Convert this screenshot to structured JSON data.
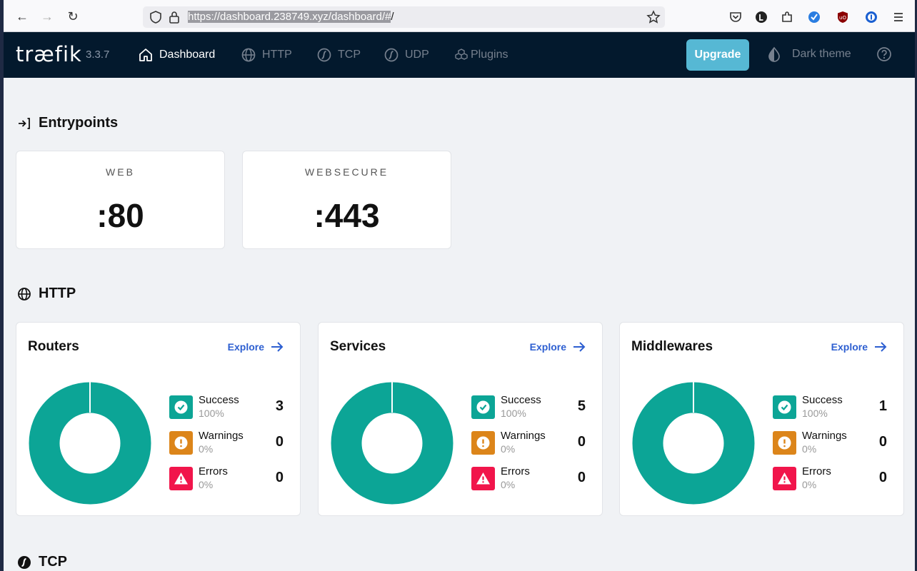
{
  "browser": {
    "url_selected": "https://dashboard.238749.xyz/dashboard/#",
    "url_rest": "/"
  },
  "header": {
    "logo": "træfik",
    "version": "3.3.7",
    "nav": [
      {
        "label": "Dashboard",
        "icon": "home-icon",
        "active": true
      },
      {
        "label": "HTTP",
        "icon": "globe-icon",
        "active": false
      },
      {
        "label": "TCP",
        "icon": "tcp-icon",
        "active": false
      },
      {
        "label": "UDP",
        "icon": "udp-icon",
        "active": false
      },
      {
        "label": "Plugins",
        "icon": "plugins-icon",
        "active": false
      }
    ],
    "upgrade_label": "Upgrade",
    "dark_theme_label": "Dark theme"
  },
  "entrypoints": {
    "title": "Entrypoints",
    "items": [
      {
        "name": "WEB",
        "port": ":80"
      },
      {
        "name": "WEBSECURE",
        "port": ":443"
      }
    ]
  },
  "http": {
    "title": "HTTP",
    "cards": [
      {
        "title": "Routers",
        "explore": "Explore",
        "success": {
          "label": "Success",
          "pct": "100%",
          "count": "3"
        },
        "warnings": {
          "label": "Warnings",
          "pct": "0%",
          "count": "0"
        },
        "errors": {
          "label": "Errors",
          "pct": "0%",
          "count": "0"
        }
      },
      {
        "title": "Services",
        "explore": "Explore",
        "success": {
          "label": "Success",
          "pct": "100%",
          "count": "5"
        },
        "warnings": {
          "label": "Warnings",
          "pct": "0%",
          "count": "0"
        },
        "errors": {
          "label": "Errors",
          "pct": "0%",
          "count": "0"
        }
      },
      {
        "title": "Middlewares",
        "explore": "Explore",
        "success": {
          "label": "Success",
          "pct": "100%",
          "count": "1"
        },
        "warnings": {
          "label": "Warnings",
          "pct": "0%",
          "count": "0"
        },
        "errors": {
          "label": "Errors",
          "pct": "0%",
          "count": "0"
        }
      }
    ]
  },
  "tcp": {
    "title": "TCP"
  },
  "colors": {
    "header_bg": "#03192d",
    "success": "#0ca596",
    "warning": "#dc851a",
    "error": "#f1154b",
    "upgrade": "#56b8d4",
    "link": "#2d5fd1"
  }
}
